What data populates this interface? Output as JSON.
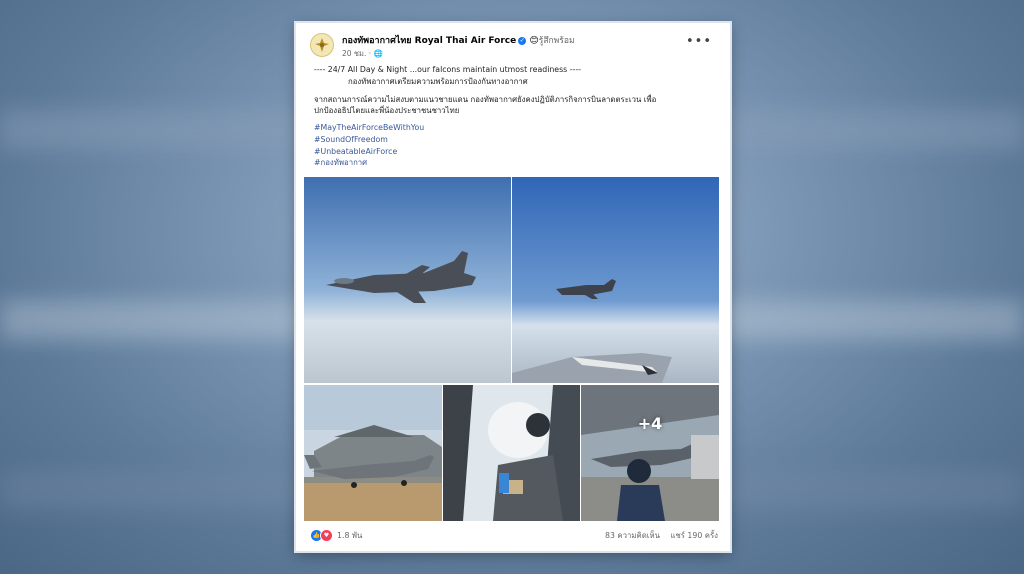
{
  "post": {
    "page_name": "กองทัพอากาศไทย Royal Thai Air Force",
    "feeling": "รู้สึกพร้อม",
    "time": "20 ชม. ·",
    "more_icon": "more-horizontal-icon",
    "text_line1": "---- 24/7 All Day & Night ...our falcons maintain utmost readiness ----",
    "text_line2": "กองทัพอากาศเตรียมความพร้อมการป้องกันทางอากาศ",
    "text_para2_line1": "จากสถานการณ์ความไม่สงบตามแนวชายแดน กองทัพอากาศยังคงปฏิบัติภารกิจการบินลาดตระเวน เพื่อ",
    "text_para2_line2": "ปกป้องอธิปไตยและพี่น้องประชาชนชาวไทย",
    "hashtags": [
      "#MayTheAirForceBeWithYou",
      "#SoundOfFreedom",
      "#UnbeatableAirForce",
      "#กองทัพอากาศ"
    ],
    "more_photos_label": "+4",
    "reaction_count": "1.8 พัน",
    "comments": "83 ความคิดเห็น",
    "shares": "แชร์ 190 ครั้ง"
  },
  "colors": {
    "link": "#385898",
    "like": "#1877f2",
    "love": "#f33e58"
  }
}
